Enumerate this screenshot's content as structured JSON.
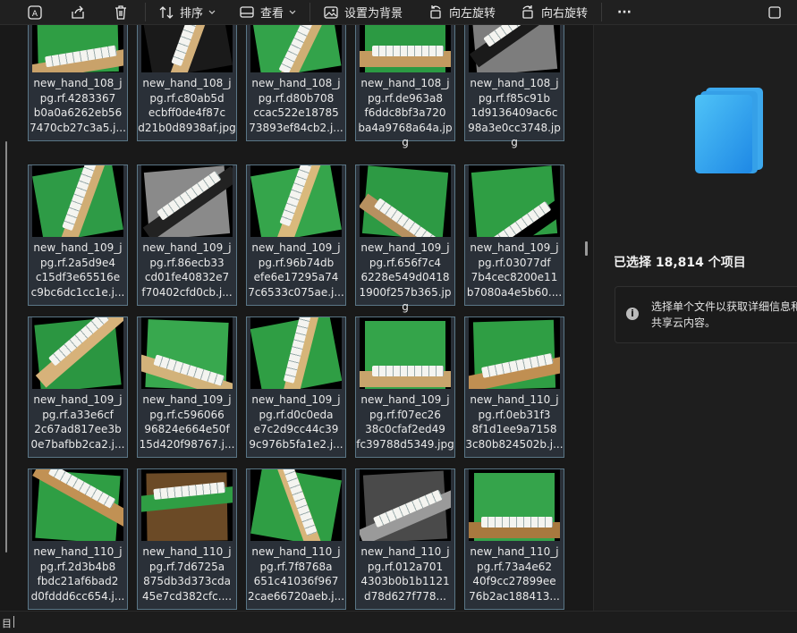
{
  "toolbar": {
    "sort_label": "排序",
    "view_label": "查看",
    "set_background_label": "设置为背景",
    "rotate_left_label": "向左旋转",
    "rotate_right_label": "向右旋转",
    "more_label": "···"
  },
  "files": [
    {
      "name": "new_hand_108_jpg.rf.4283367b0a0a6262eb567470cb27c3a5.j...",
      "thumb": "green-table"
    },
    {
      "name": "new_hand_108_jpg.rf.c80ab5decbff0de4f87cd21b0d8938af.jpg",
      "thumb": "wood-vertical"
    },
    {
      "name": "new_hand_108_jpg.rf.d80b708ccac522e1878573893ef84cb2.j...",
      "thumb": "green-vertical"
    },
    {
      "name": "new_hand_108_jpg.rf.de963a8f6ddc8bf3a720ba4a9768a64a.jpg",
      "thumb": "green-wood-bottom"
    },
    {
      "name": "new_hand_108_jpg.rf.f85c91b1d9136409ac6c98a3e0cc3748.jpg",
      "thumb": "gray-diagonal"
    },
    {
      "name": "new_hand_109_jpg.rf.2a5d9e4c15df3e65516ec9bc6dc1cc1e.j...",
      "thumb": "green-diagonal"
    },
    {
      "name": "new_hand_109_jpg.rf.86ecb33cd01fe40832e7f70402cfd0cb.j...",
      "thumb": "gray-octagon"
    },
    {
      "name": "new_hand_109_jpg.rf.96b74dbefe6e17295a747c6533c075ae.j...",
      "thumb": "green-diagonal-wood"
    },
    {
      "name": "new_hand_109_jpg.rf.656f7c46228e549d04181900f257b365.jpg",
      "thumb": "green-tilt"
    },
    {
      "name": "new_hand_109_jpg.rf.03077df7b4cec8200e11b7080a4e5b60....",
      "thumb": "green-octagon"
    },
    {
      "name": "new_hand_109_jpg.rf.a33e6cf2c67ad817ee3b0e7bafbb2ca2.j...",
      "thumb": "green-wood-diagonal"
    },
    {
      "name": "new_hand_109_jpg.rf.c59606696824e664e50f15d420f98767.j...",
      "thumb": "green-wood-tilt"
    },
    {
      "name": "new_hand_109_jpg.rf.d0c0edae7c2d9cc44c399c976b5fa1e2.j...",
      "thumb": "green-octagon-vertical"
    },
    {
      "name": "new_hand_109_jpg.rf.f07ec2638c0cfaf2ed49fc39788d5349.jpg",
      "thumb": "green-flat"
    },
    {
      "name": "new_hand_110_jpg.rf.0eb31f38f1d1ee9a71583c80b824502b.j...",
      "thumb": "green-wood-rotated"
    },
    {
      "name": "new_hand_110_jpg.rf.2d3b4b8fbdc21af6bad2d0fddd6cc654.j...",
      "thumb": "green-octagon-2"
    },
    {
      "name": "new_hand_110_jpg.rf.7d6725a875db3d373cda45e7cd382cfc....",
      "thumb": "wood-green-band"
    },
    {
      "name": "new_hand_110_jpg.rf.7f8768a651c41036f9672cae66720aeb.j...",
      "thumb": "green-diamond"
    },
    {
      "name": "new_hand_110_jpg.rf.012a7014303b0b1b1121d78d627f778...",
      "thumb": "gray-bw"
    },
    {
      "name": "new_hand_110_jpg.rf.73a4e6240f9cc27899ee76b2ac188413...",
      "thumb": "green-wood-flat"
    }
  ],
  "details": {
    "selected_count": "已选择 18,814 个项目",
    "info_text": "选择单个文件以获取详细信息和共享云内容。"
  },
  "statusbar": {
    "left_text": "目"
  }
}
